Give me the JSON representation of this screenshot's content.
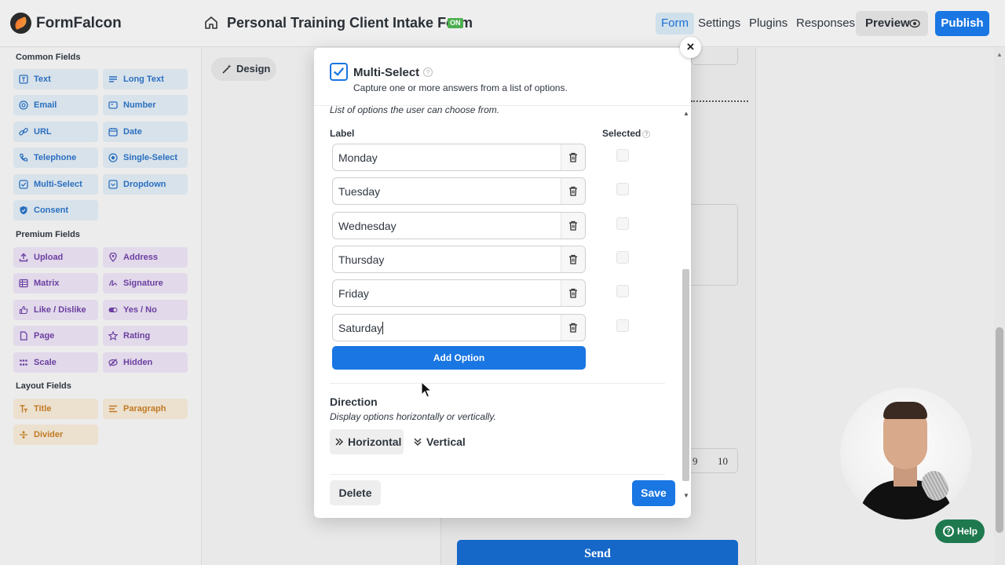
{
  "app": {
    "name": "FormFalcon",
    "form_title": "Personal Training Client Intake Form",
    "status_badge": "ON"
  },
  "nav": {
    "form": "Form",
    "settings": "Settings",
    "plugins": "Plugins",
    "responses": "Responses",
    "preview": "Preview",
    "publish": "Publish"
  },
  "colors": {
    "primary": "#1976e3",
    "common_field": "#2a6fc0",
    "premium_field": "#6a3fa0",
    "layout_field": "#c07a23",
    "help": "#1e7a4e"
  },
  "sidebar": {
    "common_title": "Common Fields",
    "common": [
      {
        "label": "Text",
        "icon": "text-icon"
      },
      {
        "label": "Long Text",
        "icon": "long-text-icon"
      },
      {
        "label": "Email",
        "icon": "at-icon"
      },
      {
        "label": "Number",
        "icon": "number-icon"
      },
      {
        "label": "URL",
        "icon": "link-icon"
      },
      {
        "label": "Date",
        "icon": "calendar-icon"
      },
      {
        "label": "Telephone",
        "icon": "phone-icon"
      },
      {
        "label": "Single-Select",
        "icon": "radio-icon"
      },
      {
        "label": "Multi-Select",
        "icon": "checkbox-icon"
      },
      {
        "label": "Dropdown",
        "icon": "dropdown-icon"
      },
      {
        "label": "Consent",
        "icon": "shield-icon"
      }
    ],
    "premium_title": "Premium Fields",
    "premium": [
      {
        "label": "Upload",
        "icon": "upload-icon"
      },
      {
        "label": "Address",
        "icon": "pin-icon"
      },
      {
        "label": "Matrix",
        "icon": "matrix-icon"
      },
      {
        "label": "Signature",
        "icon": "signature-icon"
      },
      {
        "label": "Like / Dislike",
        "icon": "thumbs-icon"
      },
      {
        "label": "Yes / No",
        "icon": "toggle-icon"
      },
      {
        "label": "Page",
        "icon": "page-icon"
      },
      {
        "label": "Rating",
        "icon": "star-icon"
      },
      {
        "label": "Scale",
        "icon": "scale-icon"
      },
      {
        "label": "Hidden",
        "icon": "eye-off-icon"
      }
    ],
    "layout_title": "Layout Fields",
    "layout": [
      {
        "label": "Title",
        "icon": "title-icon"
      },
      {
        "label": "Paragraph",
        "icon": "paragraph-icon"
      },
      {
        "label": "Divider",
        "icon": "divider-icon"
      }
    ]
  },
  "canvas": {
    "design_label": "Design",
    "scale_9": "9",
    "scale_10": "10",
    "send_label": "Send"
  },
  "modal": {
    "close": "×",
    "title": "Multi-Select",
    "subtitle": "Capture one or more answers from a list of options.",
    "options_description": "List of options the user can choose from.",
    "label_header": "Label",
    "selected_header": "Selected",
    "options": [
      {
        "label": "Monday",
        "selected": false
      },
      {
        "label": "Tuesday",
        "selected": false
      },
      {
        "label": "Wednesday",
        "selected": false
      },
      {
        "label": "Thursday",
        "selected": false
      },
      {
        "label": "Friday",
        "selected": false
      },
      {
        "label": "Saturday",
        "selected": false
      }
    ],
    "add_option": "Add Option",
    "direction_title": "Direction",
    "direction_description": "Display options horizontally or vertically.",
    "direction_horizontal": "Horizontal",
    "direction_vertical": "Vertical",
    "direction_selected": "Horizontal",
    "delete": "Delete",
    "save": "Save"
  },
  "help": {
    "label": "Help"
  }
}
